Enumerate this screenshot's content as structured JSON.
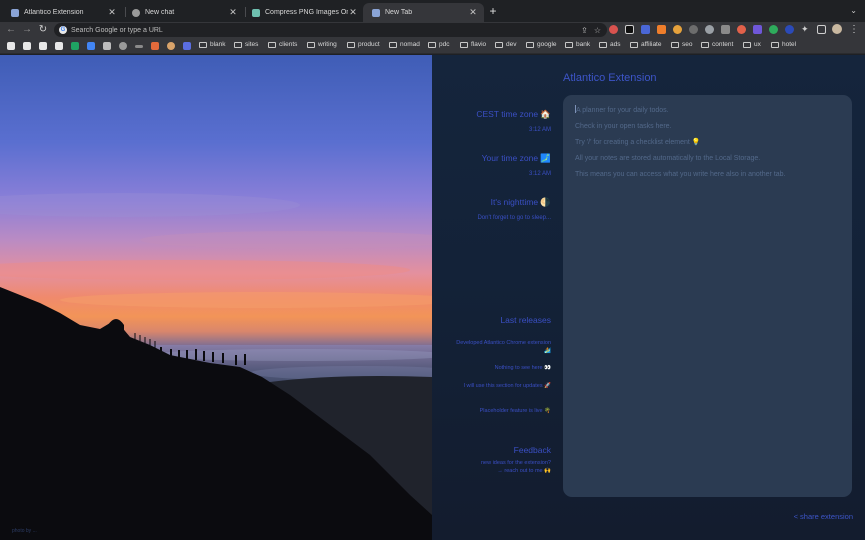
{
  "tabs": [
    {
      "title": "Atlantico Extension",
      "favicon_color": "#8aa4d6",
      "active": false
    },
    {
      "title": "New chat",
      "favicon_color": "#9a9a9a",
      "active": false
    },
    {
      "title": "Compress PNG Images Online",
      "favicon_color": "#6fc0b0",
      "active": false
    },
    {
      "title": "New Tab",
      "favicon_color": "#8aa4d6",
      "active": true
    }
  ],
  "omnibox": {
    "placeholder": "Search Google or type a URL"
  },
  "bookmarks": [
    "blank",
    "sites",
    "clients",
    "writing",
    "product",
    "nomad",
    "pdc",
    "flavio",
    "dev",
    "google",
    "bank",
    "ads",
    "affiliate",
    "seo",
    "content",
    "ux",
    "hotel"
  ],
  "photo": {
    "credit": "photo by ..."
  },
  "panel": {
    "app_title": "Atlantico Extension",
    "cest": {
      "heading": "CEST time zone 🏠",
      "time": "3:12 AM"
    },
    "local": {
      "heading": "Your time zone 🗾",
      "time": "3:12 AM"
    },
    "night": {
      "heading": "It's nighttime 🌗",
      "subtitle": "Don't forget to go to sleep..."
    },
    "releases_heading": "Last releases",
    "releases": [
      "Developed Atlantico Chrome extension 🏄",
      "Nothing to see here 👀",
      "I will use this section for updates 🚀",
      "Placeholder feature is live 🌴"
    ],
    "feedback": {
      "heading": "Feedback",
      "line1": "new ideas for the extension?",
      "line2": "→ reach out to me 🙌"
    },
    "notes": [
      "A planner for your daily todos.",
      "Check in your open tasks here.",
      "Try '/' for creating a checklist element 💡",
      "All your notes are stored automatically to the Local Storage.",
      "This means you can access what you write here also in another tab."
    ],
    "share": "< share extension"
  }
}
